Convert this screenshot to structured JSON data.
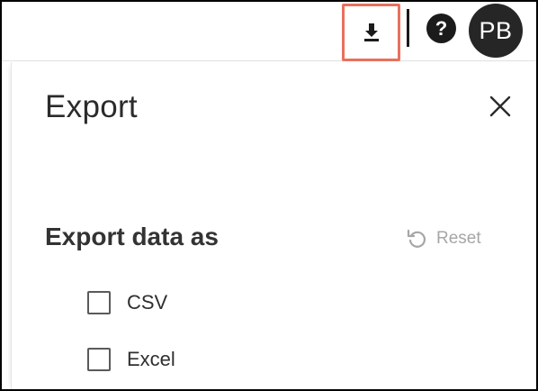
{
  "topbar": {
    "download_icon": "download-icon",
    "help_icon": "help-icon",
    "help_glyph": "?",
    "avatar_initials": "PB"
  },
  "panel": {
    "title": "Export",
    "close_icon": "close-icon",
    "section_heading": "Export data as",
    "reset_label": "Reset",
    "reset_icon": "reset-icon",
    "options": [
      {
        "label": "CSV",
        "checked": false
      },
      {
        "label": "Excel",
        "checked": false
      }
    ]
  },
  "colors": {
    "highlight_border": "#e8705f",
    "avatar_bg": "#262626",
    "reset_text": "#a6a6a6"
  }
}
